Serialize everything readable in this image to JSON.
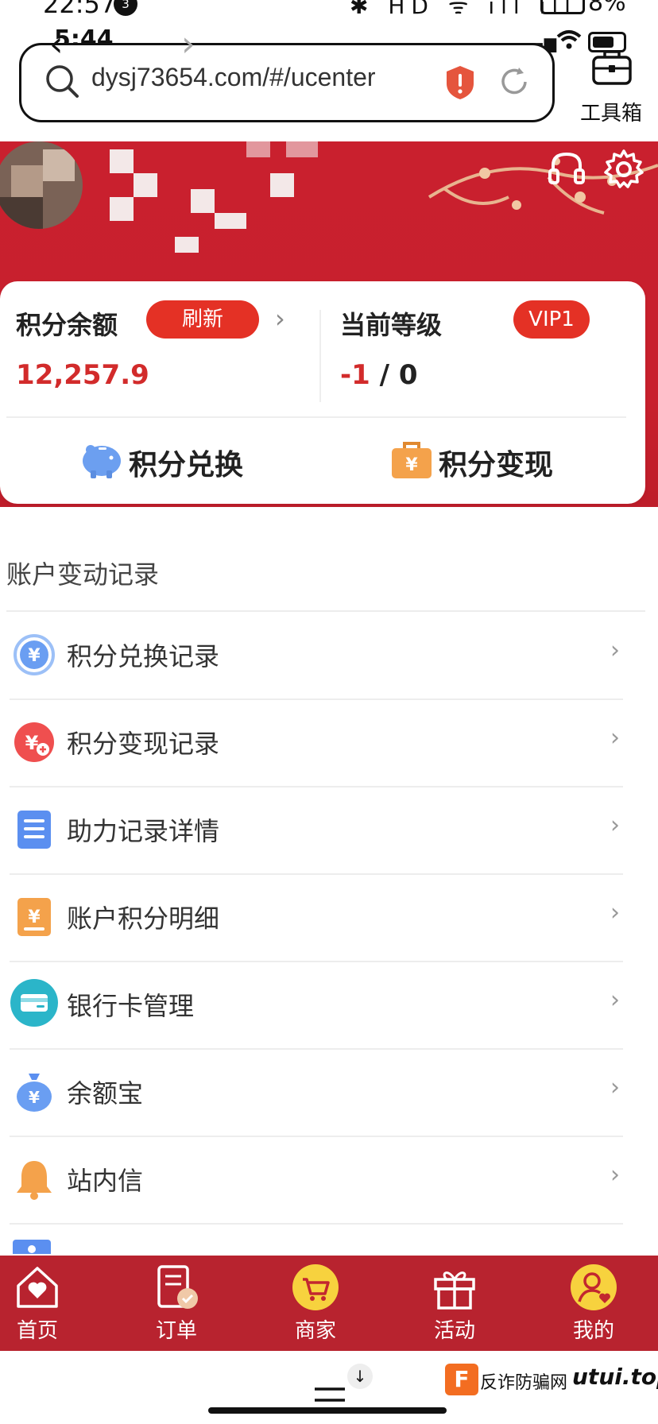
{
  "outer_status": {
    "time": "22:57",
    "badge": "3",
    "icons": "✱ HD ᯤ ıll ıll",
    "battery": "8%"
  },
  "inner_status": {
    "time": "5:44"
  },
  "browser": {
    "url": "dysj73654.com/#/ucenter",
    "toolbox_label": "工具箱"
  },
  "points_card": {
    "balance_label": "积分余额",
    "refresh_label": "刷新",
    "balance_value": "12,257.9",
    "level_label": "当前等级",
    "vip_badge": "VIP1",
    "level_current": "-1",
    "level_sep": " / ",
    "level_next": "0",
    "exchange_label": "积分兑换",
    "cashout_label": "积分变现"
  },
  "records": {
    "title": "账户变动记录",
    "items": [
      {
        "label": "积分兑换记录",
        "icon": "yen-circle-icon",
        "color": "#6a9ef2"
      },
      {
        "label": "积分变现记录",
        "icon": "yen-arrow-icon",
        "color": "#ef4f4f"
      },
      {
        "label": "助力记录详情",
        "icon": "document-icon",
        "color": "#5b8ff0"
      },
      {
        "label": "账户积分明细",
        "icon": "yen-doc-icon",
        "color": "#f4a24b"
      },
      {
        "label": "银行卡管理",
        "icon": "bank-card-icon",
        "color": "#2bb5c9"
      },
      {
        "label": "余额宝",
        "icon": "money-bag-icon",
        "color": "#5b8ff0"
      },
      {
        "label": "站内信",
        "icon": "bell-icon",
        "color": "#f4a24b"
      }
    ]
  },
  "tabbar": {
    "tabs": [
      {
        "label": "首页",
        "icon": "home-heart-icon"
      },
      {
        "label": "订单",
        "icon": "order-icon"
      },
      {
        "label": "商家",
        "icon": "cart-icon"
      },
      {
        "label": "活动",
        "icon": "gift-icon"
      },
      {
        "label": "我的",
        "icon": "profile-icon"
      }
    ]
  },
  "watermark": {
    "logo": "F",
    "text": "反诈防骗网",
    "site": "utui.top"
  },
  "colors": {
    "header_red": "#c9202e",
    "accent_red": "#e43125",
    "amount_red": "#d22b2b",
    "tab_red": "#b8232f"
  }
}
